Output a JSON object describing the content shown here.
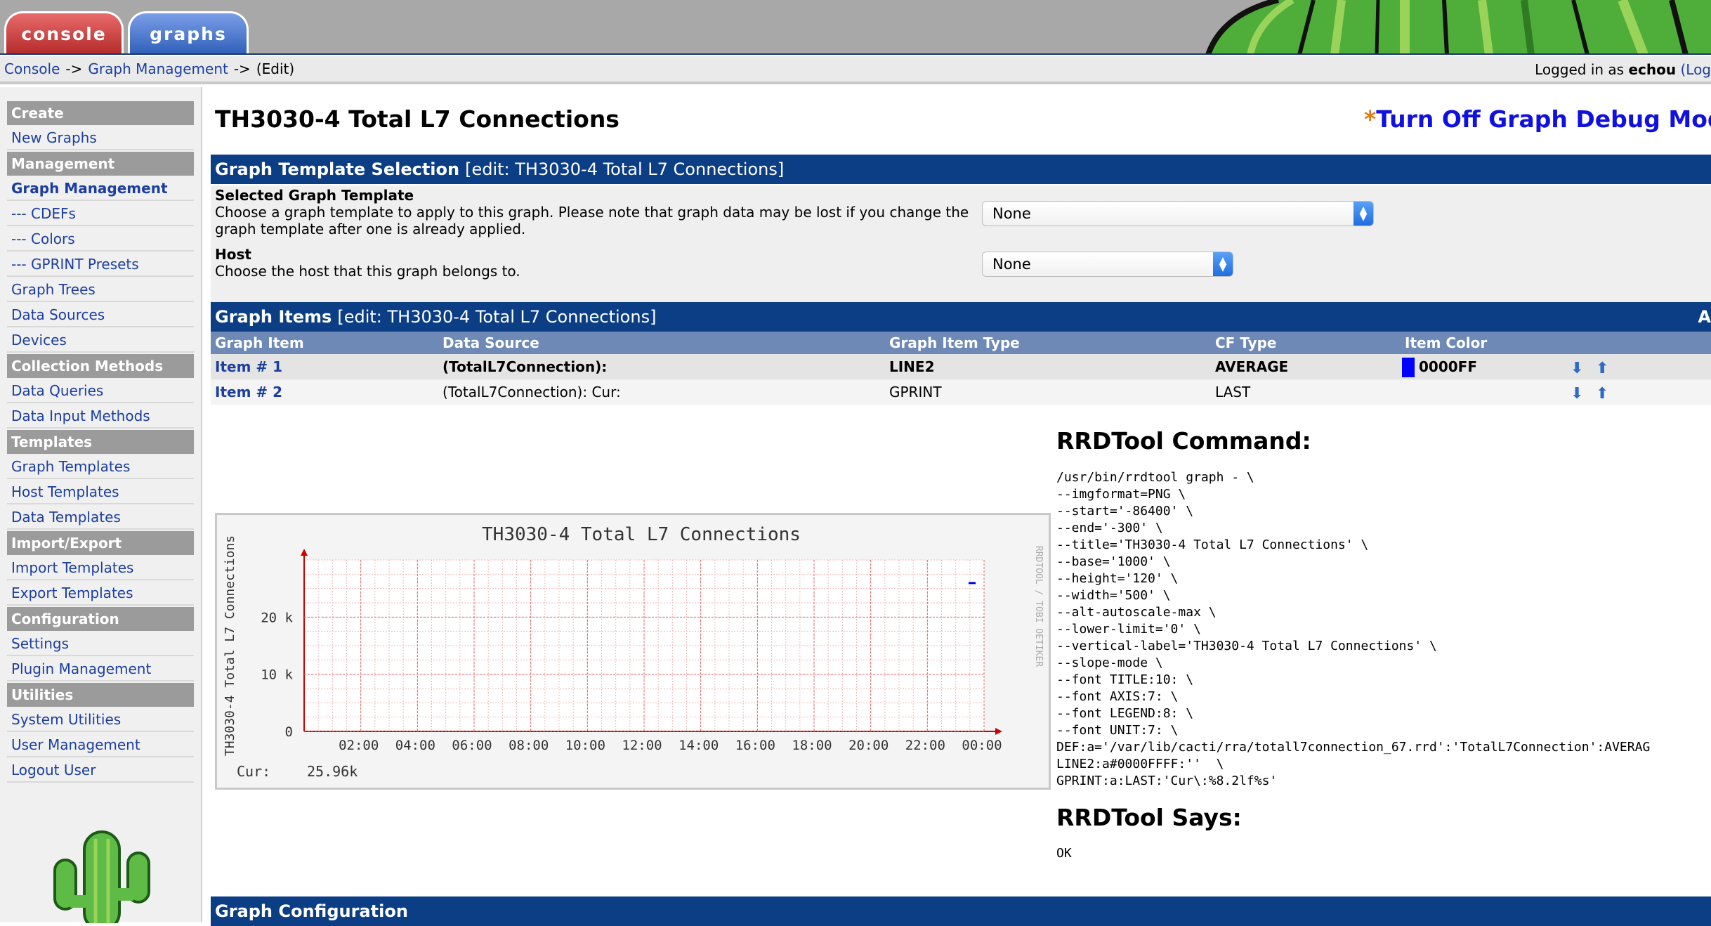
{
  "tabs": {
    "console": "console",
    "graphs": "graphs"
  },
  "breadcrumb": {
    "console": "Console",
    "graph_management": "Graph Management",
    "current": "(Edit)",
    "sep": "->"
  },
  "login": {
    "prefix": "Logged in as",
    "user": "echou",
    "link": "(Log"
  },
  "sidebar": {
    "create": "Create",
    "new_graphs": "New Graphs",
    "management": "Management",
    "graph_management": "Graph Management",
    "cdefs": "--- CDEFs",
    "colors": "--- Colors",
    "gprint": "--- GPRINT Presets",
    "graph_trees": "Graph Trees",
    "data_sources": "Data Sources",
    "devices": "Devices",
    "collection_methods": "Collection Methods",
    "data_queries": "Data Queries",
    "data_input_methods": "Data Input Methods",
    "templates": "Templates",
    "graph_templates": "Graph Templates",
    "host_templates": "Host Templates",
    "data_templates": "Data Templates",
    "import_export": "Import/Export",
    "import_templates": "Import Templates",
    "export_templates": "Export Templates",
    "configuration": "Configuration",
    "settings": "Settings",
    "plugin_management": "Plugin Management",
    "utilities": "Utilities",
    "system_utilities": "System Utilities",
    "user_management": "User Management",
    "logout_user": "Logout User"
  },
  "page": {
    "title": "TH3030-4 Total L7 Connections",
    "debug_star": "*",
    "debug": "Turn Off Graph Debug Mod"
  },
  "template_section": {
    "title": "Graph Template Selection",
    "edit": "[edit: TH3030-4 Total L7 Connections]",
    "selected_label": "Selected Graph Template",
    "selected_desc": "Choose a graph template to apply to this graph. Please note that graph data may be lost if you change the graph template after one is already applied.",
    "selected_value": "None",
    "host_label": "Host",
    "host_desc": "Choose the host that this graph belongs to.",
    "host_value": "None"
  },
  "items_section": {
    "title": "Graph Items",
    "edit": "[edit: TH3030-4 Total L7 Connections]",
    "add": "A",
    "columns": {
      "item": "Graph Item",
      "source": "Data Source",
      "type": "Graph Item Type",
      "cf": "CF Type",
      "color": "Item Color"
    },
    "rows": [
      {
        "item": "Item # 1",
        "source": "(TotalL7Connection):",
        "type": "LINE2",
        "cf": "AVERAGE",
        "color": "0000FF",
        "swatch": "#0000ff"
      },
      {
        "item": "Item # 2",
        "source": "(TotalL7Connection): Cur:",
        "type": "GPRINT",
        "cf": "LAST",
        "color": ""
      }
    ]
  },
  "graph": {
    "title": "TH3030-4 Total L7 Connections",
    "ylabel": "TH3030-4 Total L7 Connections",
    "side_text": "RRDTOOL / TOBI OETIKER",
    "yticks": [
      "20 k",
      "10 k",
      "0"
    ],
    "xticks": [
      "02:00",
      "04:00",
      "06:00",
      "08:00",
      "10:00",
      "12:00",
      "14:00",
      "16:00",
      "18:00",
      "20:00",
      "22:00",
      "00:00"
    ],
    "legend_label": "Cur:",
    "legend_value": "25.96k",
    "line_color": "#0000ff"
  },
  "chart_data": {
    "type": "line",
    "title": "TH3030-4 Total L7 Connections",
    "ylabel": "TH3030-4 Total L7 Connections",
    "x": [
      "02:00",
      "04:00",
      "06:00",
      "08:00",
      "10:00",
      "12:00",
      "14:00",
      "16:00",
      "18:00",
      "20:00",
      "22:00",
      "00:00"
    ],
    "series": [
      {
        "name": "",
        "values": [],
        "last_point": {
          "x": "23:50",
          "y": 25960
        }
      }
    ],
    "ylim": [
      0,
      30000
    ],
    "grid": true
  },
  "rrd": {
    "cmd_title": "RRDTool Command:",
    "command": "/usr/bin/rrdtool graph - \\\n--imgformat=PNG \\\n--start='-86400' \\\n--end='-300' \\\n--title='TH3030-4 Total L7 Connections' \\\n--base='1000' \\\n--height='120' \\\n--width='500' \\\n--alt-autoscale-max \\\n--lower-limit='0' \\\n--vertical-label='TH3030-4 Total L7 Connections' \\\n--slope-mode \\\n--font TITLE:10: \\\n--font AXIS:7: \\\n--font LEGEND:8: \\\n--font UNIT:7: \\\nDEF:a='/var/lib/cacti/rra/totall7connection_67.rrd':'TotalL7Connection':AVERAG\nLINE2:a#0000FFFF:''  \\\nGPRINT:a:LAST:'Cur\\:%8.2lf%s'",
    "says_title": "RRDTool Says:",
    "says": "OK"
  },
  "config_section": {
    "title": "Graph Configuration"
  }
}
